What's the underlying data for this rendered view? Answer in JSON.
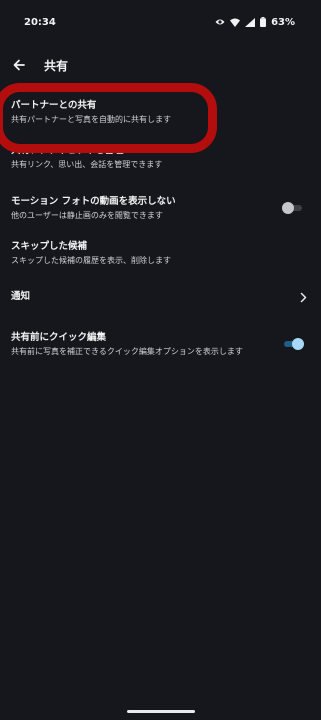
{
  "status_bar": {
    "time": "20:34",
    "battery_percent": "63%",
    "icons": [
      "eye-icon",
      "wifi-icon",
      "signal-icon",
      "battery-icon"
    ]
  },
  "app_bar": {
    "back_icon": "arrow-left-icon",
    "title": "共有"
  },
  "settings": [
    {
      "title": "パートナーとの共有",
      "subtitle": "共有パートナーと写真を自動的に共有します"
    },
    {
      "title": "共有アクティビティを管理",
      "subtitle": "共有リンク、思い出、会話を管理できます"
    },
    {
      "title": "モーション フォトの動画を表示しない",
      "subtitle": "他のユーザーは静止画のみを閲覧できます",
      "toggle": false
    },
    {
      "title": "スキップした候補",
      "subtitle": "スキップした候補の履歴を表示、削除します"
    },
    {
      "title": "通知",
      "chevron": "chevron-right-icon"
    },
    {
      "title": "共有前にクイック編集",
      "subtitle": "共有前に写真を補正できるクイック編集オプションを表示します",
      "toggle": true
    }
  ],
  "colors": {
    "background": "#15171c",
    "highlight_annotation": "#b30d0d",
    "toggle_on": "#a8d8f8",
    "toggle_off": "#c4c7cc"
  }
}
